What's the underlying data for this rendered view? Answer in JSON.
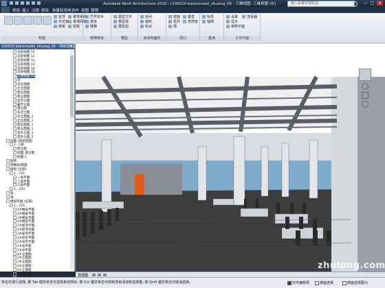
{
  "titlebar": {
    "title": "Autodesk Revit Architecture 2010 - [100510 basicmodel_zhuang_06 - 三维视图: 三维视图 25]",
    "search_placeholder": "键入关键字或短语",
    "minimize": "—",
    "maximize": "□",
    "close": "✕"
  },
  "menubar": {
    "items": [
      "常用",
      "插入",
      "注释",
      "修改",
      "体量和场地",
      "协作",
      "视图",
      "管理"
    ]
  },
  "ribbon": {
    "groups": [
      {
        "label": "构建"
      },
      {
        "label": "楼梯坡道"
      },
      {
        "label": "模型"
      },
      {
        "label": "房间和面积"
      },
      {
        "label": "洞口"
      },
      {
        "label": "基准"
      },
      {
        "label": "工作平面"
      }
    ],
    "small_buttons": [
      "屋顶",
      "天花板",
      "楼板",
      "幕墙系统",
      "幕墙网格",
      "竖梃",
      "栏杆扶手",
      "坡道",
      "楼梯",
      "模型文字",
      "模型线",
      "模型组",
      "房间",
      "面积",
      "标记",
      "按面",
      "竖井",
      "墙",
      "垂直",
      "老虎窗",
      "标高",
      "轴网",
      "设置",
      "显示",
      "参照平面",
      "查看器"
    ]
  },
  "browser": {
    "header": "100510 basicmodel_zhuang_06 - 项目浏览器",
    "items": [
      {
        "label": "渲染视图 10",
        "indent": 3
      },
      {
        "label": "渲染视图 11",
        "indent": 3
      },
      {
        "label": "渲染视图 12",
        "indent": 3
      },
      {
        "label": "渲染视图 13",
        "indent": 3
      },
      {
        "label": "渲染视图 14",
        "indent": 3
      },
      {
        "label": "渲染视图 15",
        "indent": 3
      },
      {
        "label": "三维视图 25",
        "indent": 3,
        "selected": true
      },
      {
        "label": "东",
        "indent": 3
      },
      {
        "label": "东立面图",
        "indent": 3
      },
      {
        "label": "北立面图",
        "indent": 3
      },
      {
        "label": "西立面图",
        "indent": 3
      },
      {
        "label": "南立面图",
        "indent": 3
      },
      {
        "label": "室外立面",
        "indent": 3
      },
      {
        "label": "餐厅立面",
        "indent": 3
      },
      {
        "label": "南立面",
        "indent": 3
      },
      {
        "label": "东北立面",
        "indent": 3
      },
      {
        "label": "东立面图_1",
        "indent": 3
      },
      {
        "label": "北立面图_1",
        "indent": 3
      },
      {
        "label": "西立面图_1",
        "indent": 3
      },
      {
        "label": "南立面图_1",
        "indent": 3
      },
      {
        "label": "室外立面_1",
        "indent": 3
      },
      {
        "label": "室外立面_2",
        "indent": 3
      },
      {
        "label": "剖面 (建筑剖面)",
        "indent": 1
      },
      {
        "label": "1 - 1剖",
        "indent": 2
      },
      {
        "label": "南立面",
        "indent": 3
      },
      {
        "label": "剖面_南立面",
        "indent": 3
      },
      {
        "label": "剖面 1",
        "indent": 3
      },
      {
        "label": "图例",
        "indent": 1
      },
      {
        "label": "明细表/数量",
        "indent": 1
      },
      {
        "label": "图纸 (全部)",
        "indent": 1
      },
      {
        "label": "1 - 101",
        "indent": 2
      },
      {
        "label": "一层平面",
        "indent": 3
      },
      {
        "label": "二层平面",
        "indent": 3
      },
      {
        "label": "三层平面",
        "indent": 3
      },
      {
        "label": "1 - 102",
        "indent": 2
      },
      {
        "label": "族",
        "indent": 1
      },
      {
        "label": "组",
        "indent": 1
      },
      {
        "label": "楼层平面 (全部)",
        "indent": 1
      },
      {
        "label": "1 - 101",
        "indent": 2
      },
      {
        "label": "1#楼层平面",
        "indent": 3
      },
      {
        "label": "2#楼层平面",
        "indent": 3
      },
      {
        "label": "3#楼层平面",
        "indent": 3
      },
      {
        "label": "4#楼层平面",
        "indent": 3
      },
      {
        "label": "1#屋顶平面",
        "indent": 3
      },
      {
        "label": "2#屋顶平面",
        "indent": 3
      },
      {
        "label": "3#屋顶平面",
        "indent": 3
      },
      {
        "label": "1#食堂平面",
        "indent": 3
      },
      {
        "label": "2#食堂平面",
        "indent": 3
      },
      {
        "label": "1#总平面",
        "indent": 3
      },
      {
        "label": "2#总平面",
        "indent": 3
      },
      {
        "label": "1#立面图",
        "indent": 3
      },
      {
        "label": "2#立面图",
        "indent": 3
      },
      {
        "label": "3#立面图",
        "indent": 3
      },
      {
        "label": "4#立面图",
        "indent": 3
      },
      {
        "label": "5#立面图",
        "indent": 3
      },
      {
        "label": "1#剖面图",
        "indent": 3
      },
      {
        "label": "2#剖面图",
        "indent": 3
      },
      {
        "label": "3#剖面图",
        "indent": 3
      }
    ]
  },
  "viewbar": {
    "label": "透视图"
  },
  "statusbar": {
    "message": "单击可进行选择; 按 Tab 键并单击可选择其他项目; 按 Ctrl 键并单击可将新项目添加到选择集; 按 Shift 键并单击可取消选择。",
    "checks": [
      {
        "label": "仅可编辑项",
        "on": false
      },
      {
        "label": "按面选择",
        "on": false
      },
      {
        "label": "按面选择图元",
        "on": false
      }
    ]
  },
  "watermark": "zhulong.com",
  "colors": {
    "title_bg": "#1a2738",
    "browser_header": "#3a5f92",
    "selection": "#3a66a8",
    "ceiling": "#f2f2f2",
    "floor": "#3a3a3a",
    "door": "#e05a1c"
  }
}
